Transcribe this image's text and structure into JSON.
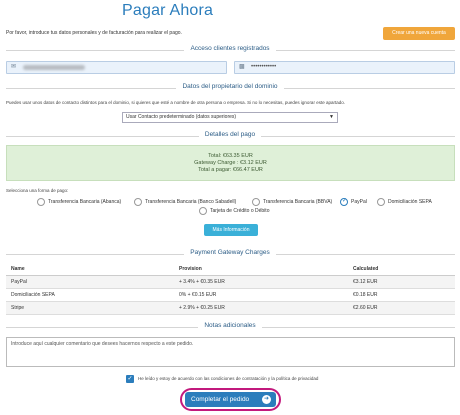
{
  "page": {
    "title": "Pagar Ahora",
    "intro": "Por favor, introduce tus datos personales y de facturación para realizar el pago.",
    "create_account_button": "Crear una nueva cuenta"
  },
  "login": {
    "section_title": "Acceso clientes registrados",
    "password_mask": "••••••••••••"
  },
  "owner": {
    "section_title": "Datos del propietario del dominio",
    "helper_text": "Puedes usar unos datos de contacto distintos para el dominio, si quieres que esté a nombre de otra persona o empresa. Si no lo necesitas, puedes ignorar este apartado.",
    "contact_select_value": "Usar Contacto predeterminado (datos superiores)"
  },
  "payment_details": {
    "section_title": "Detalles del pago",
    "total": "Total: €63.35 EUR",
    "gateway_charge": "Gateway Charge : €3.12 EUR",
    "total_to_pay": "Total a pagar: €66.47 EUR"
  },
  "payment_methods": {
    "prompt": "Selecciona una forma de pago:",
    "options": [
      {
        "label": "Transferencia Bancaria (Abanca)",
        "checked": false
      },
      {
        "label": "Transferencia Bancaria (Banco Sabadell)",
        "checked": false
      },
      {
        "label": "Transferencia Bancaria (BBVA)",
        "checked": false
      },
      {
        "label": "PayPal",
        "checked": true
      },
      {
        "label": "Domiciliación SEPA",
        "checked": false
      },
      {
        "label": "Tarjeta de Crédito o Débito",
        "checked": false
      }
    ],
    "more_info_button": "Más Información"
  },
  "gateway_charges": {
    "section_title": "Payment Gateway Charges",
    "headers": [
      "Name",
      "Provision",
      "Calculated"
    ],
    "rows": [
      [
        "PayPal",
        "+ 3.4% + €0.35 EUR",
        "€3.12 EUR"
      ],
      [
        "Domiciliación SEPA",
        "0% + €0.15 EUR",
        "€0.18 EUR"
      ],
      [
        "Stripe",
        "+ 2.9% + €0.25 EUR",
        "€2.60 EUR"
      ]
    ]
  },
  "notes": {
    "section_title": "Notas adicionales",
    "placeholder": "Introduce aquí cualquier comentario que desees hacernos respecto a este pedido."
  },
  "terms": {
    "checked": true,
    "label": "He leído y estoy de acuerdo con las condiciones de contratación y la política de privacidad"
  },
  "submit_button": "Completar el pedido",
  "colors": {
    "brand_blue": "#2b7dbc",
    "create_orange": "#f0a63b",
    "info_cyan": "#3ab0d8",
    "summary_green": "#dff0d8",
    "highlight_magenta": "#c2197d"
  }
}
